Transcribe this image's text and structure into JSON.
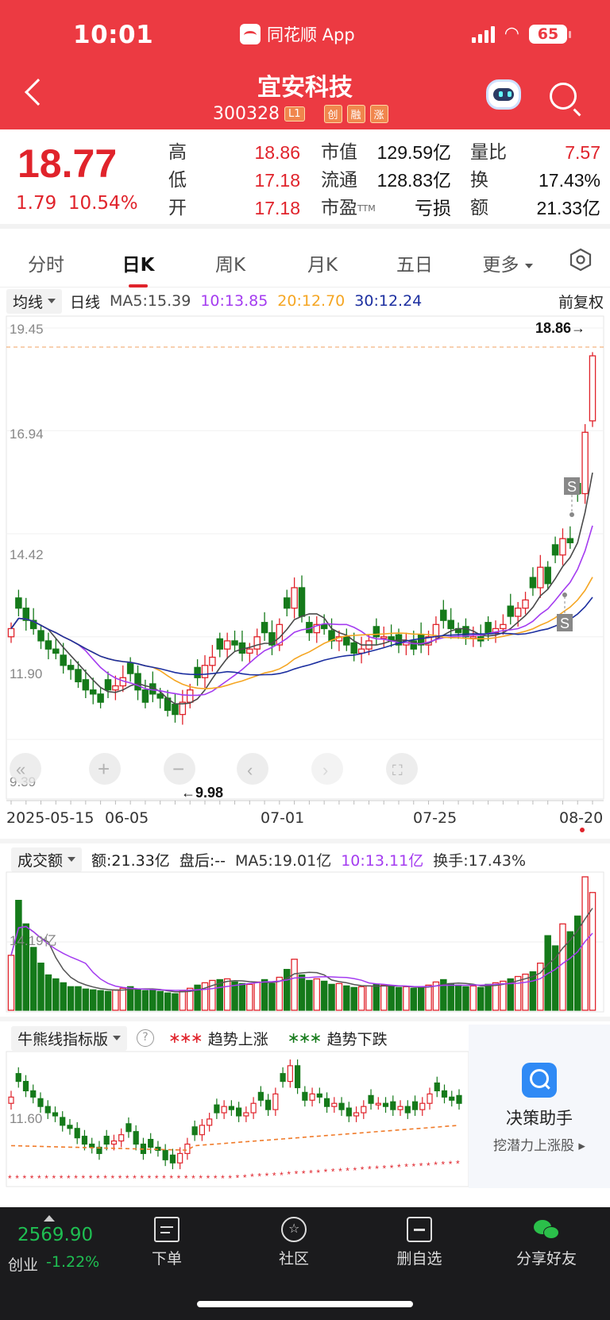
{
  "status": {
    "time": "10:01",
    "app_name": "同花顺 App",
    "battery": "65"
  },
  "stock": {
    "name": "宜安科技",
    "code": "300328",
    "tags": [
      "L1",
      "创",
      "融",
      "涨"
    ]
  },
  "quote": {
    "price": "18.77",
    "change": "1.79",
    "change_pct": "10.54%",
    "high_label": "高",
    "high": "18.86",
    "low_label": "低",
    "low": "17.18",
    "open_label": "开",
    "open": "17.18",
    "mcap_label": "市值",
    "mcap": "129.59亿",
    "float_label": "流通",
    "float": "128.83亿",
    "pe_label": "市盈",
    "pe_sup": "TTM",
    "pe": "亏损",
    "vr_label": "量比",
    "vr": "7.57",
    "turnover_label": "换",
    "turnover": "17.43%",
    "amount_label": "额",
    "amount": "21.33亿"
  },
  "tabs": [
    {
      "label": "分时",
      "active": false
    },
    {
      "label": "日K",
      "active": true
    },
    {
      "label": "周K",
      "active": false
    },
    {
      "label": "月K",
      "active": false
    },
    {
      "label": "五日",
      "active": false
    },
    {
      "label": "更多",
      "active": false
    }
  ],
  "ma_bar": {
    "selector": "均线",
    "period": "日线",
    "ma5": "MA5:15.39",
    "ma10": "10:13.85",
    "ma20": "20:12.70",
    "ma30": "30:12.24",
    "adjust": "前复权"
  },
  "colors": {
    "up": "#e0232b",
    "down": "#157a1a",
    "ma5": "#4a4a4a",
    "ma10": "#a43cf0",
    "ma20": "#f5a623",
    "ma30": "#1c2fa0"
  },
  "kchart_labels": {
    "y_ticks": [
      "19.45",
      "16.94",
      "14.42",
      "11.90",
      "9.39"
    ],
    "max_marker": "18.86→",
    "min_marker": "←9.98",
    "dates": [
      "2025-05-15",
      "06-05",
      "07-01",
      "07-25",
      "08-20"
    ],
    "signals": [
      "S",
      "S"
    ]
  },
  "chart_data": {
    "type": "candlestick",
    "y_ticks": [
      19.45,
      16.94,
      14.42,
      11.9,
      9.39
    ],
    "ylim": [
      9.39,
      19.45
    ],
    "x_labels": [
      "2025-05-15",
      "06-05",
      "07-01",
      "07-25",
      "08-20"
    ],
    "max_price": 18.86,
    "min_price": 9.98,
    "close_series": [
      12.1,
      12.6,
      12.3,
      12.1,
      11.8,
      11.6,
      11.5,
      11.2,
      11.1,
      10.8,
      10.6,
      10.5,
      10.3,
      10.6,
      10.7,
      10.9,
      11.0,
      10.6,
      10.3,
      10.5,
      10.4,
      10.1,
      10.0,
      10.3,
      10.6,
      10.9,
      11.2,
      11.4,
      11.6,
      11.8,
      11.7,
      11.5,
      11.6,
      11.9,
      12.0,
      11.7,
      12.2,
      12.6,
      13.1,
      12.4,
      12.0,
      12.2,
      12.1,
      11.8,
      11.9,
      11.7,
      11.5,
      11.6,
      11.8,
      11.9,
      11.9,
      11.8,
      11.7,
      11.8,
      11.6,
      11.7,
      11.9,
      12.2,
      12.3,
      12.1,
      12.0,
      11.9,
      11.9,
      11.8,
      12.0,
      12.1,
      12.2,
      12.4,
      12.6,
      12.8,
      13.1,
      13.6,
      13.2,
      13.9,
      14.3,
      14.2,
      15.4,
      16.9,
      18.77
    ],
    "ma5_last": 15.39,
    "ma10_last": 13.85,
    "ma20_last": 12.7,
    "ma30_last": 12.24
  },
  "volume": {
    "selector": "成交额",
    "amount": "额:21.33亿",
    "after_hours": "盘后:--",
    "ma5": "MA5:19.01亿",
    "ma10": "10:13.11亿",
    "turnover": "换手:17.43%",
    "y_label": "14.19亿",
    "values": [
      7,
      14,
      11,
      8,
      6,
      4.5,
      4,
      3.5,
      3,
      3,
      2.7,
      2.6,
      2.5,
      2.4,
      2.6,
      2.8,
      3,
      2.7,
      2.5,
      2.6,
      2.4,
      2.2,
      2.1,
      2.5,
      2.8,
      3.2,
      3.5,
      3.8,
      3.9,
      4,
      3.6,
      3.4,
      3.3,
      3.6,
      3.9,
      3.4,
      4.2,
      5.2,
      6.5,
      4.5,
      3.8,
      4,
      3.7,
      3.3,
      3.4,
      3.1,
      2.9,
      3,
      3.1,
      3.3,
      3.2,
      3,
      2.9,
      3,
      2.8,
      2.9,
      3.2,
      3.6,
      3.9,
      3.4,
      3.2,
      3,
      3.1,
      2.9,
      3.3,
      3.5,
      3.7,
      4,
      4.3,
      4.6,
      4.9,
      6,
      9.5,
      8.2,
      11,
      10,
      12,
      17,
      15
    ]
  },
  "bull_bear": {
    "selector": "牛熊线指标版",
    "help": "?",
    "up_legend": "趋势上涨",
    "down_legend": "趋势下跌",
    "y_label": "11.60"
  },
  "promo": {
    "title": "决策助手",
    "subtitle": "挖潜力上涨股 ▸"
  },
  "bottom": {
    "index_value": "2569.90",
    "index_name": "创业",
    "index_change": "-1.22%",
    "nav": [
      "下单",
      "社区",
      "删自选",
      "分享好友"
    ]
  }
}
